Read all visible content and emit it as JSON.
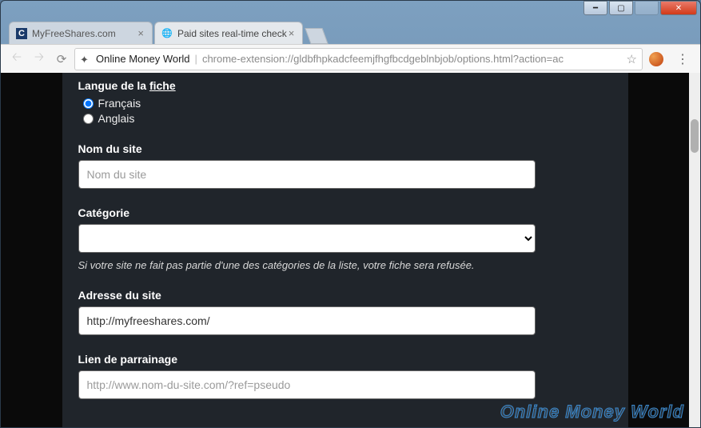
{
  "window": {
    "tabs": [
      {
        "title": "MyFreeShares.com",
        "favicon_letter": "C",
        "active": false
      },
      {
        "title": "Paid sites real-time check",
        "favicon_letter": "",
        "active": true
      }
    ]
  },
  "toolbar": {
    "title": "Online Money World",
    "url": "chrome-extension://gldbfhpkadcfeemjfhgfbcdgeblnbjob/options.html?action=ac"
  },
  "form": {
    "langue": {
      "label_prefix": "Langue de la ",
      "label_underline": "fiche",
      "options": [
        {
          "label": "Français",
          "checked": true
        },
        {
          "label": "Anglais",
          "checked": false
        }
      ]
    },
    "nom": {
      "label": "Nom du site",
      "placeholder": "Nom du site",
      "value": ""
    },
    "categorie": {
      "label": "Catégorie",
      "helper": "Si votre site ne fait pas partie d'une des catégories de la liste, votre fiche sera refusée."
    },
    "adresse": {
      "label": "Adresse du site",
      "value": "http://myfreeshares.com/"
    },
    "parrainage": {
      "label": "Lien de parrainage",
      "placeholder": "http://www.nom-du-site.com/?ref=pseudo",
      "value": ""
    }
  },
  "watermark": "Online Money World"
}
